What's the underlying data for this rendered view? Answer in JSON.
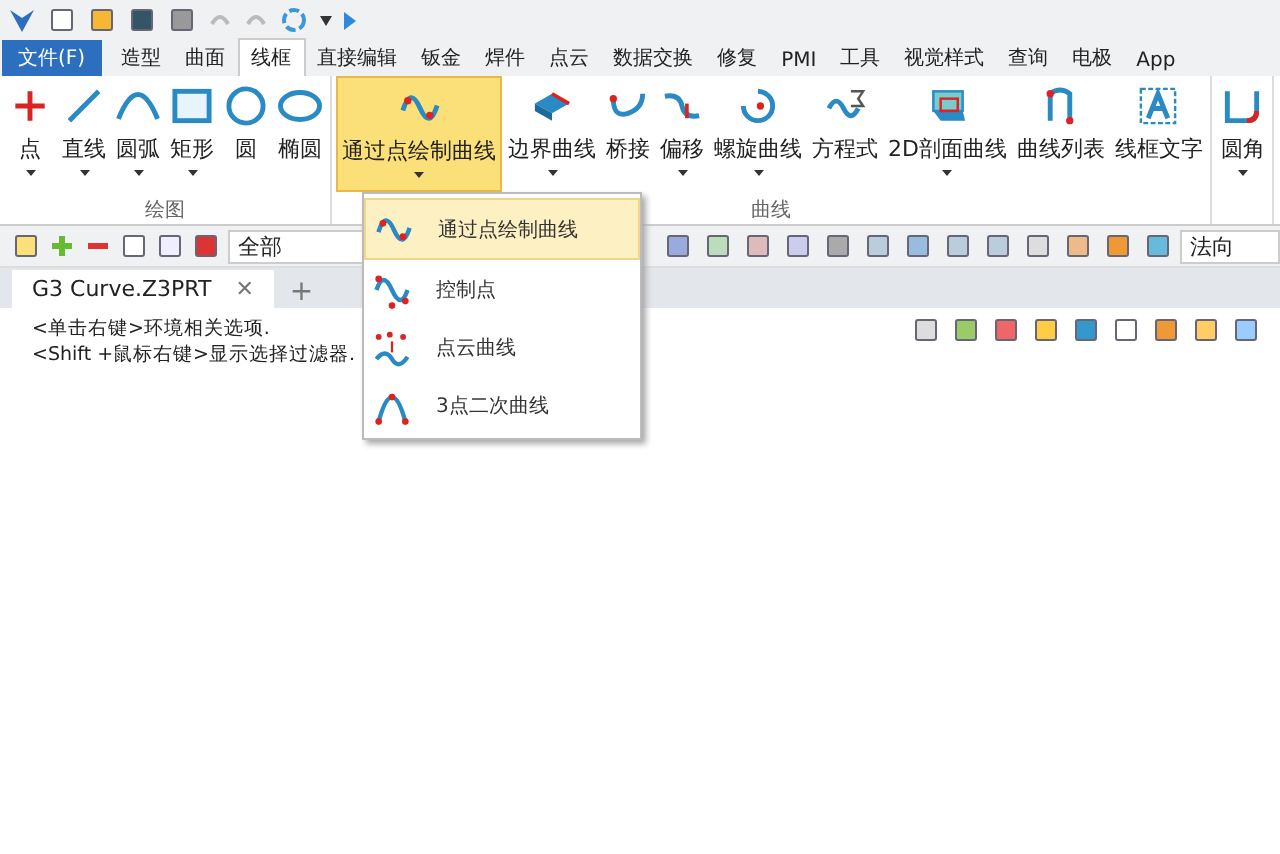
{
  "menu_tabs": [
    {
      "label": "文件(F)",
      "kind": "file",
      "selected": false
    },
    {
      "label": "造型",
      "kind": "tab",
      "selected": false
    },
    {
      "label": "曲面",
      "kind": "tab",
      "selected": false
    },
    {
      "label": "线框",
      "kind": "tab",
      "selected": true
    },
    {
      "label": "直接编辑",
      "kind": "tab",
      "selected": false
    },
    {
      "label": "钣金",
      "kind": "tab",
      "selected": false
    },
    {
      "label": "焊件",
      "kind": "tab",
      "selected": false
    },
    {
      "label": "点云",
      "kind": "tab",
      "selected": false
    },
    {
      "label": "数据交换",
      "kind": "tab",
      "selected": false
    },
    {
      "label": "修复",
      "kind": "tab",
      "selected": false
    },
    {
      "label": "PMI",
      "kind": "tab",
      "selected": false
    },
    {
      "label": "工具",
      "kind": "tab",
      "selected": false
    },
    {
      "label": "视觉样式",
      "kind": "tab",
      "selected": false
    },
    {
      "label": "查询",
      "kind": "tab",
      "selected": false
    },
    {
      "label": "电极",
      "kind": "tab",
      "selected": false
    },
    {
      "label": "App",
      "kind": "tab",
      "selected": false
    }
  ],
  "ribbon_groups": [
    {
      "label": "绘图",
      "items": [
        {
          "label": "点",
          "dropdown": true,
          "selected": false
        },
        {
          "label": "直线",
          "dropdown": true,
          "selected": false
        },
        {
          "label": "圆弧",
          "dropdown": true,
          "selected": false
        },
        {
          "label": "矩形",
          "dropdown": true,
          "selected": false
        },
        {
          "label": "圆",
          "dropdown": false,
          "selected": false
        },
        {
          "label": "椭圆",
          "dropdown": false,
          "selected": false
        }
      ]
    },
    {
      "label": "曲线",
      "items": [
        {
          "label": "通过点绘制曲线",
          "dropdown": true,
          "selected": true
        },
        {
          "label": "边界曲线",
          "dropdown": true,
          "selected": false
        },
        {
          "label": "桥接",
          "dropdown": false,
          "selected": false
        },
        {
          "label": "偏移",
          "dropdown": true,
          "selected": false
        },
        {
          "label": "螺旋曲线",
          "dropdown": true,
          "selected": false
        },
        {
          "label": "方程式",
          "dropdown": false,
          "selected": false
        },
        {
          "label": "2D剖面曲线",
          "dropdown": true,
          "selected": false
        },
        {
          "label": "曲线列表",
          "dropdown": false,
          "selected": false
        },
        {
          "label": "线框文字",
          "dropdown": false,
          "selected": false
        }
      ]
    },
    {
      "items": [
        {
          "label": "圆角",
          "dropdown": true,
          "selected": false
        }
      ]
    }
  ],
  "filter": {
    "value": "全部"
  },
  "direction_field": {
    "value": "法向"
  },
  "document_tab": {
    "title": "G3 Curve.Z3PRT",
    "close": "✕",
    "add": "+"
  },
  "canvas_hints": [
    "<单击右键>环境相关选项.",
    "<Shift +鼠标右键>显示选择过滤器."
  ],
  "dropdown_menu": [
    {
      "label": "通过点绘制曲线",
      "selected": true
    },
    {
      "label": "控制点",
      "selected": false
    },
    {
      "label": "点云曲线",
      "selected": false
    },
    {
      "label": "3点二次曲线",
      "selected": false
    }
  ]
}
